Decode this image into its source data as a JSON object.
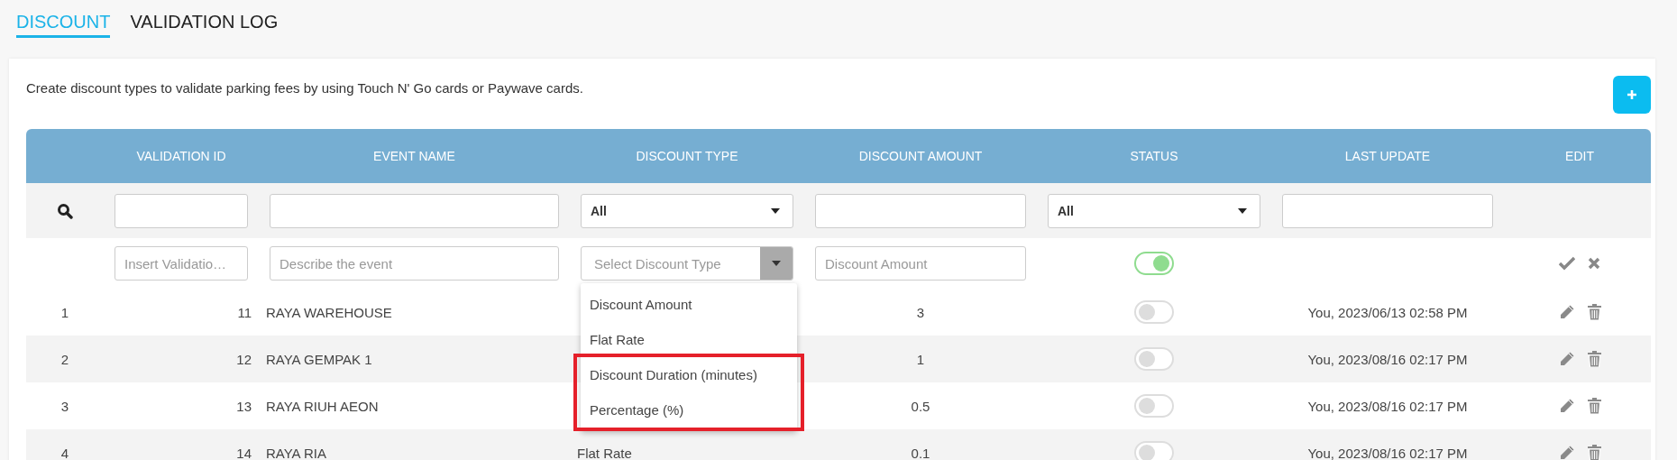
{
  "tabs": [
    {
      "label": "DISCOUNT",
      "selected": true
    },
    {
      "label": "VALIDATION LOG",
      "selected": false
    }
  ],
  "description": "Create discount types to validate parking fees by using Touch N' Go cards or Paywave cards.",
  "table": {
    "columns": [
      "VALIDATION ID",
      "EVENT NAME",
      "DISCOUNT TYPE",
      "DISCOUNT AMOUNT",
      "STATUS",
      "LAST UPDATE",
      "EDIT"
    ],
    "filters": [
      {
        "kind": "text"
      },
      {
        "kind": "text"
      },
      {
        "kind": "select",
        "value": "All"
      },
      {
        "kind": "text"
      },
      {
        "kind": "select",
        "value": "All"
      },
      {
        "kind": "text"
      }
    ],
    "new_row": {
      "fields": [
        {
          "kind": "text",
          "placeholder": "Insert Validatio…"
        },
        {
          "kind": "text",
          "placeholder": "Describe the event"
        },
        {
          "kind": "select",
          "placeholder": "Select Discount Type"
        },
        {
          "kind": "text",
          "placeholder": "Discount Amount"
        }
      ],
      "active": true
    },
    "dropdown": {
      "options": [
        {
          "label": "Discount Amount",
          "highlighted": false
        },
        {
          "label": "Flat Rate",
          "highlighted": false
        },
        {
          "label": "Discount Duration (minutes)",
          "highlighted": true
        },
        {
          "label": "Percentage (%)",
          "highlighted": true
        }
      ]
    },
    "rows": [
      {
        "index": "1",
        "validation_id": "11",
        "event_name": "RAYA WAREHOUSE",
        "discount_amount": "3",
        "active": false,
        "last_update": "You, 2023/06/13 02:58 PM"
      },
      {
        "index": "2",
        "validation_id": "12",
        "event_name": "RAYA GEMPAK 1",
        "discount_amount": "1",
        "active": false,
        "last_update": "You, 2023/08/16 02:17 PM"
      },
      {
        "index": "3",
        "validation_id": "13",
        "event_name": "RAYA RIUH AEON",
        "discount_amount": "0.5",
        "active": false,
        "last_update": "You, 2023/08/16 02:17 PM"
      },
      {
        "index": "4",
        "validation_id": "14",
        "event_name": "RAYA RIA",
        "discount_type": "Flat Rate",
        "discount_amount": "0.1",
        "active": false,
        "last_update": "You, 2023/08/16 02:17 PM"
      }
    ]
  }
}
